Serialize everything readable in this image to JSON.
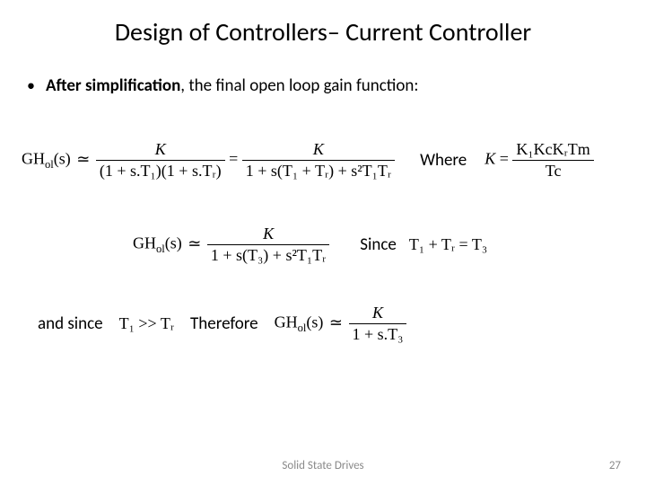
{
  "title": "Design of Controllers– Current Controller",
  "bullet": {
    "lead": "After simplification",
    "rest": ", the final open loop gain function:"
  },
  "labels": {
    "where": "Where",
    "since": "Since",
    "and_since": "and since",
    "therefore": "Therefore"
  },
  "math": {
    "ghol": "GH",
    "ol": "ol",
    "s": "(s)",
    "approx": "≃",
    "eq": "=",
    "K": "K",
    "den1a": "(1 + s.T₁)(1 + s.Tᵣ)",
    "den1b": "1 + s(T₁ + Tᵣ) + s²T₁Tᵣ",
    "k_def_num": "K₁KcKᵣTm",
    "k_def_den": "Tc",
    "den2": "1 + s(T₃) + s²T₁Tᵣ",
    "t3_def": "T₁ + Tᵣ = T₃",
    "t1_gg_tr": "T₁ >> Tᵣ",
    "den3": "1 + s.T₃"
  },
  "footer": "Solid State Drives",
  "page": "27"
}
